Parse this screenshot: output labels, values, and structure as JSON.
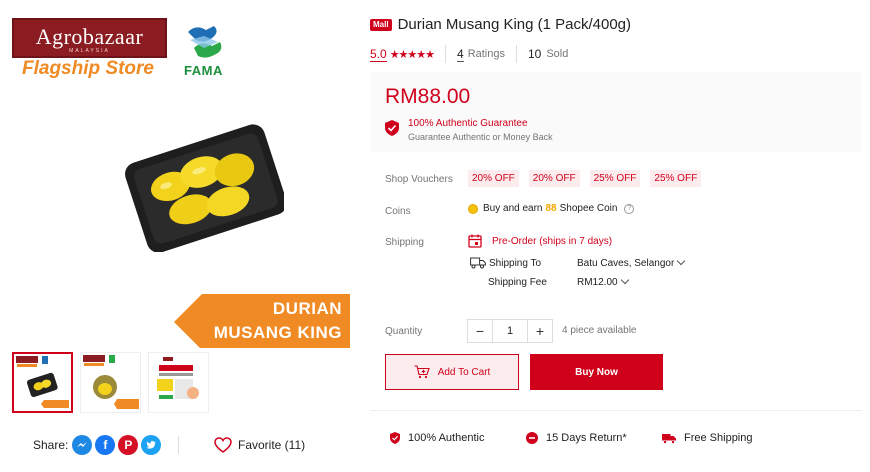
{
  "store": {
    "brand_name": "Agrobazaar",
    "brand_sub": "MALAYSIA",
    "store_type": "Flagship Store",
    "partner_name": "FAMA"
  },
  "hero_banner": {
    "line1": "DURIAN",
    "line2": "MUSANG KING"
  },
  "thumbnails": [
    "thumb-1",
    "thumb-2",
    "thumb-3"
  ],
  "share": {
    "label": "Share:"
  },
  "favorite": {
    "label": "Favorite (11)"
  },
  "product": {
    "badge": "Mall",
    "title": "Durian Musang King (1 Pack/400g)",
    "rating": "5.0",
    "stars": "★★★★★",
    "ratings_count": "4",
    "ratings_label": "Ratings",
    "sold_count": "10",
    "sold_label": "Sold",
    "price": "RM88.00",
    "guarantee_title": "100% Authentic Guarantee",
    "guarantee_sub": "Guarantee Authentic or Money Back"
  },
  "details": {
    "vouchers_label": "Shop Vouchers",
    "vouchers": [
      "20% OFF",
      "20% OFF",
      "25% OFF",
      "25% OFF"
    ],
    "coins_label": "Coins",
    "coins_prefix": "Buy and earn",
    "coins_amount": "88",
    "coins_suffix": "Shopee Coin",
    "shipping_label": "Shipping",
    "preorder_text": "Pre-Order (ships in 7 days)",
    "ship_to_label": "Shipping To",
    "ship_to_value": "Batu Caves, Selangor",
    "ship_fee_label": "Shipping Fee",
    "ship_fee_value": "RM12.00",
    "quantity_label": "Quantity",
    "quantity_value": "1",
    "available_text": "4 piece available"
  },
  "actions": {
    "add_to_cart": "Add To Cart",
    "buy_now": "Buy Now"
  },
  "assurances": [
    "100% Authentic",
    "15 Days Return*",
    "Free Shipping"
  ],
  "colors": {
    "accent": "#d0011b",
    "banner_orange": "#f08a24",
    "brand_maroon": "#8b1d22",
    "coin_gold": "#f6a700"
  }
}
